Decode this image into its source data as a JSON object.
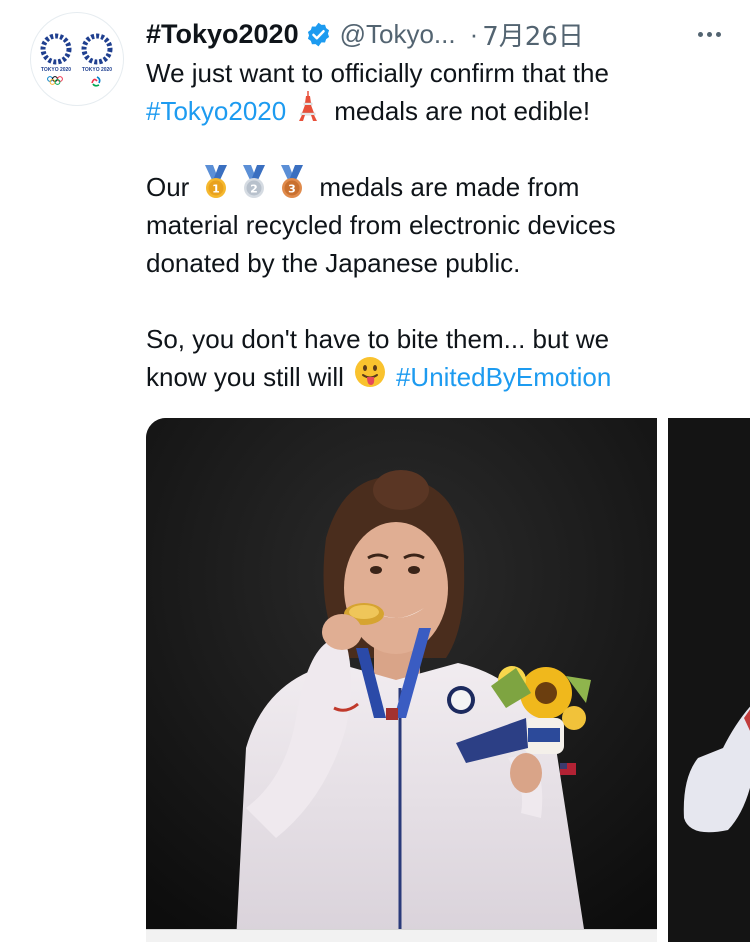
{
  "tweet": {
    "display_name": "#Tokyo2020",
    "handle": "@Tokyo...",
    "separator": "·",
    "date": "7月26日",
    "text_lines": {
      "l1": "We just want to officially confirm that the",
      "l2_tag": "#Tokyo2020",
      "l2_rest": "medals are not edible!",
      "l3_start": "Our",
      "l3_rest": "medals are made from",
      "l4": "material recycled from electronic devices",
      "l5": "donated by the Japanese public.",
      "l6": "So, you don't have to bite them... but we",
      "l7_start": "know you still will",
      "l7_tag": "#UnitedByEmotion"
    },
    "medal_emoji_numbers": [
      "1",
      "2",
      "3"
    ],
    "avatar_logo_labels": [
      "TOKYO 2020",
      "TOKYO 2020"
    ],
    "accent_color": "#1d9bf0",
    "verified_color": "#1d9bf0",
    "icons": [
      "verified-badge-icon",
      "more-options-icon",
      "tokyo-tower-icon",
      "gold-medal-icon",
      "silver-medal-icon",
      "bronze-medal-icon",
      "tongue-face-icon"
    ]
  }
}
